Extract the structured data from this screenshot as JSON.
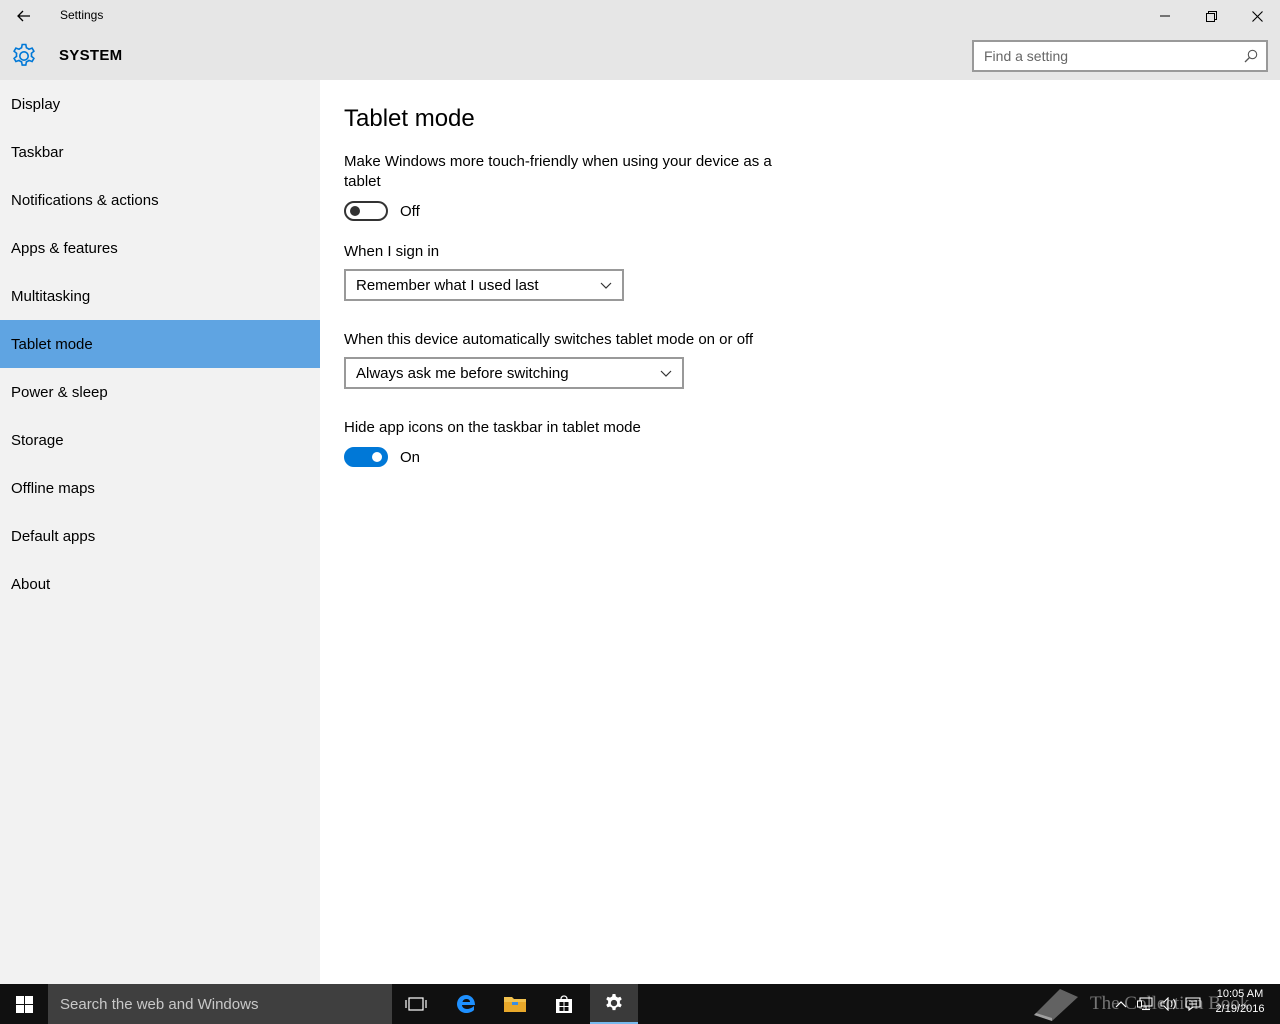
{
  "window": {
    "title": "Settings"
  },
  "header": {
    "app_title": "SYSTEM",
    "search_placeholder": "Find a setting"
  },
  "sidebar": {
    "items": [
      {
        "label": "Display"
      },
      {
        "label": "Taskbar"
      },
      {
        "label": "Notifications & actions"
      },
      {
        "label": "Apps & features"
      },
      {
        "label": "Multitasking"
      },
      {
        "label": "Tablet mode"
      },
      {
        "label": "Power & sleep"
      },
      {
        "label": "Storage"
      },
      {
        "label": "Offline maps"
      },
      {
        "label": "Default apps"
      },
      {
        "label": "About"
      }
    ],
    "selected": "Tablet mode"
  },
  "main": {
    "title": "Tablet mode",
    "touch_friendly": {
      "description": "Make Windows more touch-friendly when using your device as a tablet",
      "state_label": "Off"
    },
    "sign_in": {
      "label": "When I sign in",
      "value": "Remember what I used last"
    },
    "auto_switch": {
      "label": "When this device automatically switches tablet mode on or off",
      "value": "Always ask me before switching"
    },
    "hide_icons": {
      "label": "Hide app icons on the taskbar in tablet mode",
      "state_label": "On"
    }
  },
  "taskbar": {
    "search_text": "Search the web and Windows",
    "watermark": "The Collection Book",
    "clock_time": "10:05 AM",
    "clock_date": "2/19/2016"
  },
  "colors": {
    "accent": "#0078d7",
    "sidebar_selected": "#5fa4e2",
    "chrome": "#e6e6e6",
    "sidebar_bg": "#f2f2f2",
    "taskbar_bg": "#101010"
  }
}
